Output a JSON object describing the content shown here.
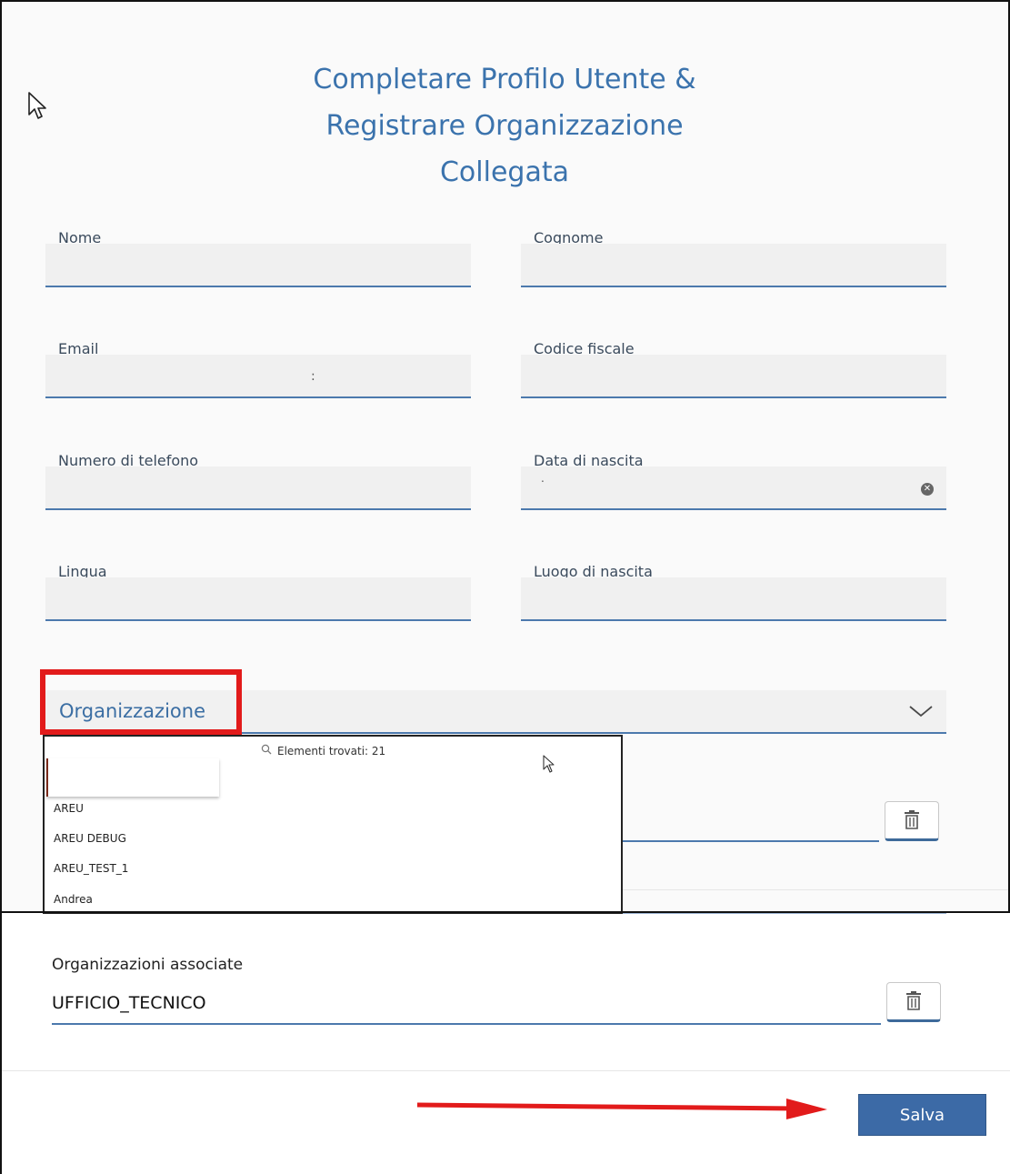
{
  "title": {
    "line1": "Completare Profilo Utente &",
    "line2": "Registrare Organizzazione",
    "line3": "Collegata"
  },
  "fields": {
    "nome": {
      "label": "Nome",
      "value": ""
    },
    "cognome": {
      "label": "Cognome",
      "value": ""
    },
    "email": {
      "label": "Email",
      "value": ":"
    },
    "codice_fiscale": {
      "label": "Codice fiscale",
      "value": ""
    },
    "telefono": {
      "label": "Numero di telefono",
      "value": ""
    },
    "data_nascita": {
      "label": "Data di nascita",
      "value": "."
    },
    "lingua": {
      "label": "Lingua",
      "value": ""
    },
    "luogo_nascita": {
      "label": "Luogo di nascita",
      "value": ""
    }
  },
  "organizzazione": {
    "label": "Organizzazione",
    "dropdown": {
      "found_text": "Elementi trovati: 21",
      "search_value": "",
      "options": [
        "AREU",
        "AREU DEBUG",
        "AREU_TEST_1",
        "Andrea"
      ]
    }
  },
  "associate": {
    "label": "Organizzazioni associate",
    "value": "UFFICIO_TECNICO"
  },
  "actions": {
    "save_label": "Salva"
  },
  "icons": {
    "trash": "trash-icon",
    "chevron": "chevron-down-icon",
    "clear": "clear-circle-icon",
    "search": "search-icon",
    "cursor": "mouse-pointer-icon"
  },
  "colors": {
    "accent": "#3b73ad",
    "highlight": "#e21b1b",
    "button": "#3c6aa6"
  }
}
